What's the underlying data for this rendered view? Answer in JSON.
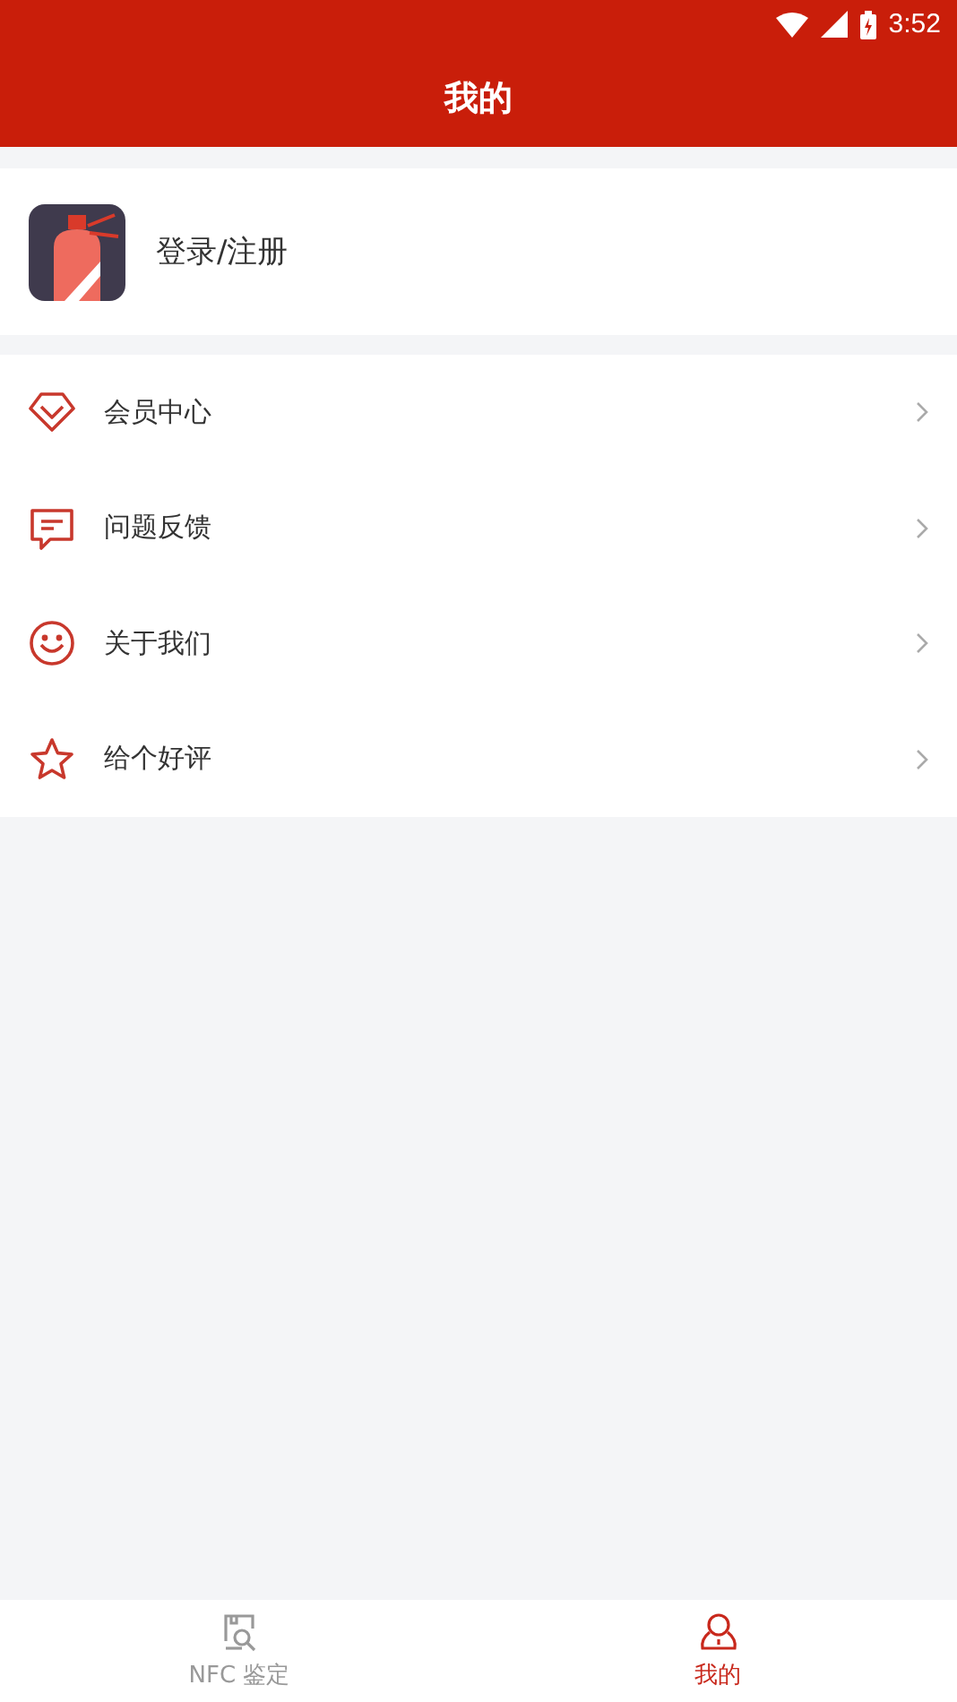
{
  "status_bar": {
    "time": "3:52"
  },
  "header": {
    "title": "我的"
  },
  "profile": {
    "label": "登录/注册"
  },
  "menu": [
    {
      "kind": "diamond",
      "label": "会员中心"
    },
    {
      "kind": "chat",
      "label": "问题反馈"
    },
    {
      "kind": "smile",
      "label": "关于我们"
    },
    {
      "kind": "star",
      "label": "给个好评"
    }
  ],
  "tabs": [
    {
      "kind": "scan",
      "label": "NFC 鉴定",
      "selected": false
    },
    {
      "kind": "person",
      "label": "我的",
      "selected": true
    }
  ]
}
